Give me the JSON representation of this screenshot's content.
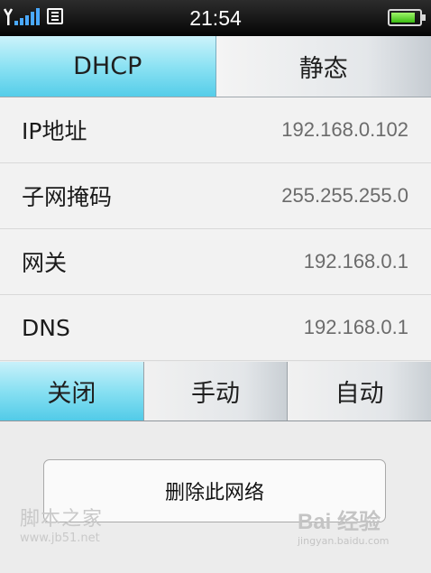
{
  "status_bar": {
    "time": "21:54",
    "battery_level": 0.85,
    "signal_icon": "signal-bars-icon",
    "sim_icon": "sim-card-icon"
  },
  "mode_tabs": [
    {
      "label": "DHCP",
      "selected": true
    },
    {
      "label": "静态",
      "selected": false
    }
  ],
  "settings": [
    {
      "label": "IP地址",
      "value": "192.168.0.102"
    },
    {
      "label": "子网掩码",
      "value": "255.255.255.0"
    },
    {
      "label": "网关",
      "value": "192.168.0.1"
    },
    {
      "label": "DNS",
      "value": "192.168.0.1"
    }
  ],
  "proxy_segments": [
    {
      "label": "关闭",
      "selected": true
    },
    {
      "label": "手动",
      "selected": false
    },
    {
      "label": "自动",
      "selected": false
    }
  ],
  "delete_button_label": "删除此网络",
  "watermarks": {
    "left_title": "脚本之家",
    "left_url": "www.jb51.net",
    "right_title": "Bai 经验",
    "right_url": "jingyan.baidu.com"
  },
  "colors": {
    "accent_cyan": "#55cde9",
    "status_bar": "#050505",
    "battery_green": "#3bbd12"
  }
}
